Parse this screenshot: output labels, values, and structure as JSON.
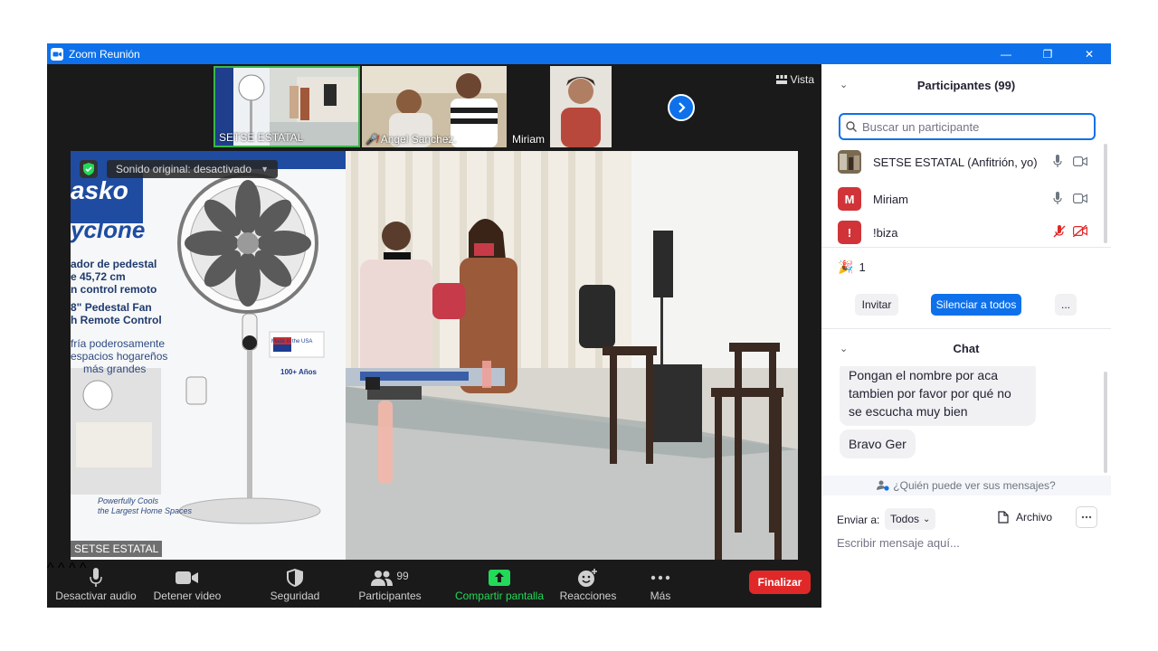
{
  "window": {
    "title": "Zoom Reunión",
    "controls": {
      "minimize": "—",
      "restore": "❐",
      "close": "✕"
    }
  },
  "thumbnails": [
    {
      "name": "SETSE ESTATAL",
      "muted": false,
      "active": true
    },
    {
      "name": "Angel Sanchez.",
      "muted": true,
      "active": false
    },
    {
      "name": "Miriam",
      "muted": false,
      "active": false
    }
  ],
  "view_button": {
    "label": "Vista"
  },
  "main_video": {
    "sound_label": "Sonido original: desactivado",
    "speaker_name": "SETSE ESTATAL",
    "box_brand": "asko",
    "box_model": "yclone",
    "box_text_1": "ador de pedestal",
    "box_text_2": "e 45,72 cm",
    "box_text_3": "n control remoto",
    "box_text_4": "8\" Pedestal Fan",
    "box_text_5": "h Remote Control",
    "box_text_6": "fría poderosamente",
    "box_text_7": "espacios hogareños",
    "box_text_8": "más grandes",
    "box_made": "Made in the USA",
    "box_years": "100+ Años",
    "box_footer_1": "Powerfully Cools",
    "box_footer_2": "the Largest Home Spaces"
  },
  "toolbar": {
    "audio": "Desactivar audio",
    "video": "Detener video",
    "security": "Seguridad",
    "participants": "Participantes",
    "participants_count": "99",
    "share": "Compartir pantalla",
    "reactions": "Reacciones",
    "more": "Más",
    "end": "Finalizar"
  },
  "participants_panel": {
    "title": "Participantes (99)",
    "search_placeholder": "Buscar un participante",
    "rows": [
      {
        "name": "SETSE ESTATAL (Anfitrión, yo)",
        "avatar": "",
        "color": "#6b5a45",
        "muted": false
      },
      {
        "name": "Miriam",
        "avatar": "M",
        "color": "#d13438",
        "muted": false
      },
      {
        "name": "!biza",
        "avatar": "!",
        "color": "#d13438",
        "muted": true
      }
    ],
    "raised_count": "1",
    "invite": "Invitar",
    "mute_all": "Silenciar a todos",
    "more": "..."
  },
  "chat": {
    "title": "Chat",
    "messages": [
      {
        "line1": "Pongan el nombre por aca",
        "line2": "tambien por favor por qué no",
        "line3": "se escucha muy bien"
      },
      {
        "line1": "Bravo Ger"
      }
    ],
    "visibility": "¿Quién puede ver sus mensajes?",
    "send_to_label": "Enviar a:",
    "send_to_value": "Todos",
    "file_label": "Archivo",
    "input_placeholder": "Escribir mensaje aquí..."
  },
  "colors": {
    "accent": "#0e71eb",
    "end": "#e02828",
    "share": "#23d959"
  }
}
